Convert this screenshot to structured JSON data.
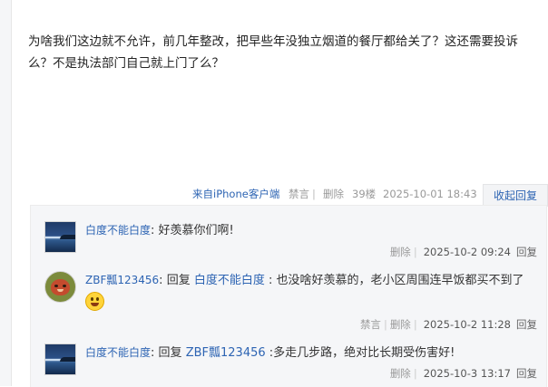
{
  "post": {
    "content": "为啥我们这边就不允许，前几年整改，把早些年没独立烟道的餐厅都给关了？这还需要投诉么？不是执法部门自己就上门了么？",
    "tail": {
      "client": "来自iPhone客户端",
      "ban": "禁言",
      "delete": "删除",
      "floor": "39楼",
      "time": "2025-10-01 18:43",
      "collapse_reply": "收起回复"
    }
  },
  "replies": [
    {
      "user": "白度不能白度",
      "colon": ":",
      "content": "好羡慕你们啊!",
      "delete": "删除",
      "time": "2025-10-2 09:24",
      "reply": "回复"
    },
    {
      "user": "ZBF瓢123456",
      "colon": ":",
      "reply_word": "回复",
      "target": "白度不能白度",
      "content": ": 也没啥好羡慕的，老小区周围连早饭都买不到了",
      "ban": "禁言",
      "delete": "删除",
      "time": "2025-10-2 11:28",
      "reply": "回复"
    },
    {
      "user": "白度不能白度",
      "colon": ":",
      "reply_word": "回复",
      "target": "ZBF瓢123456",
      "content": ":多走几步路，绝对比长期受伤害好!",
      "delete": "删除",
      "time": "2025-10-3 13:17",
      "reply": "回复"
    }
  ],
  "icons": [
    "sea-avatar",
    "pig-avatar",
    "grin-emoji-icon"
  ],
  "colors": {
    "link": "#2d64b3",
    "reply_bg": "#f5f6f8"
  }
}
